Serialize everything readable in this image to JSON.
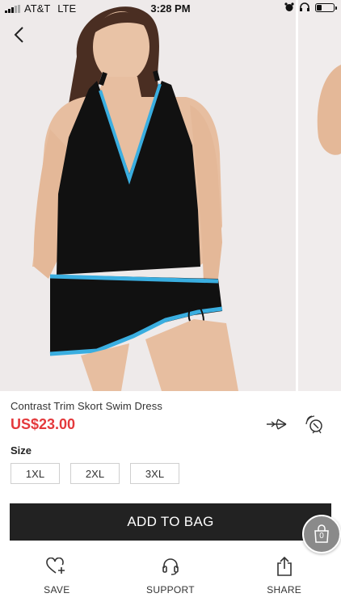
{
  "status_bar": {
    "carrier": "AT&T",
    "network": "LTE",
    "time": "3:28 PM",
    "battery_level": 0.3
  },
  "product": {
    "title": "Contrast Trim Skort Swim Dress",
    "price": "US$23.00",
    "price_color": "#e4393c"
  },
  "size": {
    "label": "Size",
    "options": [
      "1XL",
      "2XL",
      "3XL"
    ]
  },
  "actions": {
    "add_to_bag": "ADD TO BAG",
    "cart_count": "0"
  },
  "bottom_bar": {
    "save": "SAVE",
    "support": "SUPPORT",
    "share": "SHARE"
  },
  "icons": {
    "back": "chevron-left-icon",
    "share_link": "paper-plane-icon",
    "pinterest_like": "satellite-icon",
    "cart": "shopping-bag-icon",
    "save": "heart-plus-icon",
    "support": "headset-icon",
    "share": "share-upload-icon"
  }
}
